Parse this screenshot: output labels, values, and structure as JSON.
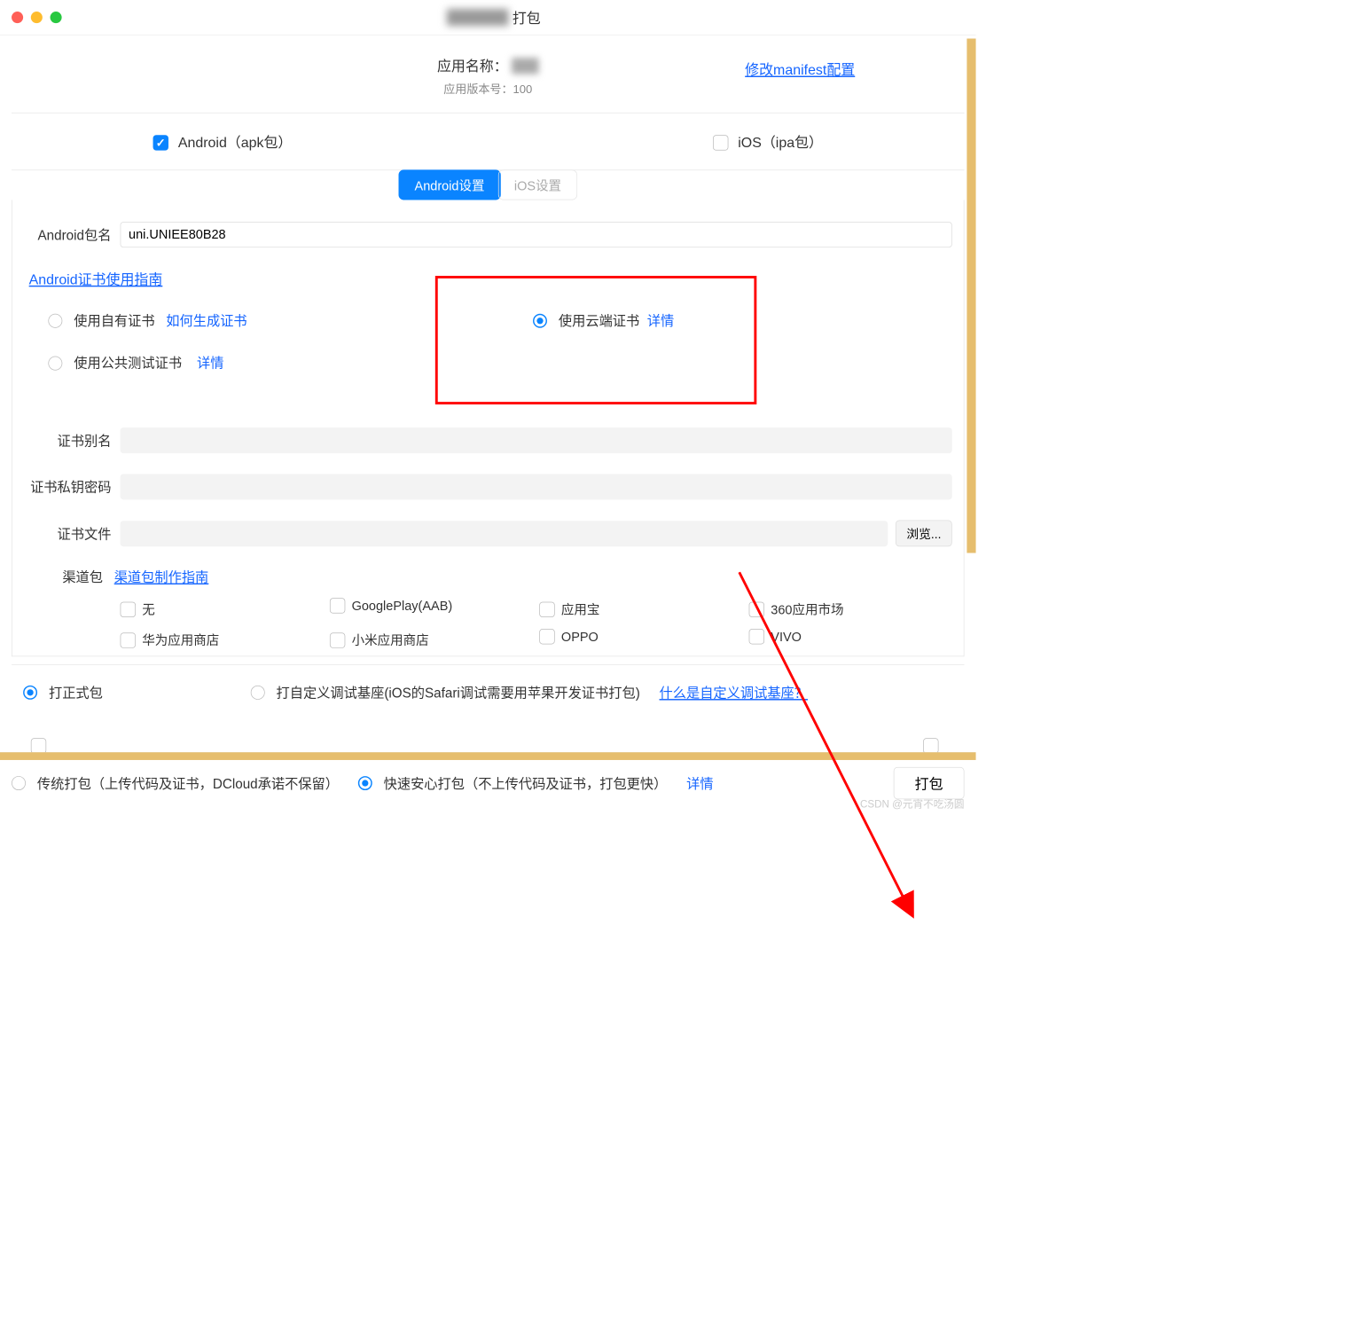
{
  "window": {
    "title_suffix": "打包"
  },
  "app": {
    "name_label": "应用名称：",
    "version_label": "应用版本号：",
    "version_value": "100",
    "modify_manifest": "修改manifest配置"
  },
  "platforms": {
    "android_label": "Android（apk包）",
    "ios_label": "iOS（ipa包）"
  },
  "tabs": {
    "android": "Android设置",
    "ios": "iOS设置"
  },
  "android": {
    "package_label": "Android包名",
    "package_value": "uni.UNIEE80B28",
    "cert_guide": "Android证书使用指南",
    "own_cert": "使用自有证书",
    "how_gen": "如何生成证书",
    "cloud_cert": "使用云端证书",
    "cloud_detail": "详情",
    "public_cert": "使用公共测试证书",
    "public_detail": "详情",
    "alias_label": "证书别名",
    "key_pwd_label": "证书私钥密码",
    "cert_file_label": "证书文件",
    "browse": "浏览...",
    "channel_label": "渠道包",
    "channel_guide": "渠道包制作指南",
    "channels": {
      "none": "无",
      "google": "GooglePlay(AAB)",
      "yyb": "应用宝",
      "360": "360应用市场",
      "huawei": "华为应用商店",
      "xiaomi": "小米应用商店",
      "oppo": "OPPO",
      "vivo": "VIVO"
    }
  },
  "build_type": {
    "formal": "打正式包",
    "custom": "打自定义调试基座(iOS的Safari调试需要用苹果开发证书打包)",
    "what_is": "什么是自定义调试基座？"
  },
  "bottom": {
    "traditional": "传统打包（上传代码及证书，DCloud承诺不保留）",
    "fast": "快速安心打包（不上传代码及证书，打包更快）",
    "detail": "详情",
    "package_btn": "打包"
  },
  "watermark": "CSDN @元宵不吃汤圆"
}
